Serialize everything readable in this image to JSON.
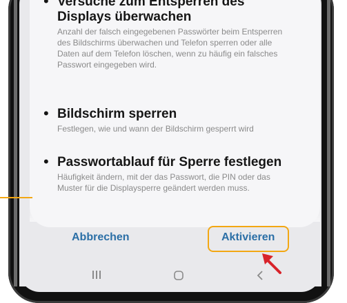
{
  "items": [
    {
      "title": "Versuche zum Entsperren des Displays überwachen",
      "desc": "Anzahl der falsch eingegebenen Passwörter beim Entsperren des Bildschirms überwachen und Telefon sperren oder alle Daten auf dem Telefon löschen, wenn zu häufig ein falsches Passwort eingegeben wird."
    },
    {
      "title": "Bildschirm sperren",
      "desc": "Festlegen, wie und wann der Bildschirm gesperrt wird"
    },
    {
      "title": "Passwortablauf für Sperre festlegen",
      "desc": "Häufigkeit ändern, mit der das Passwort, die PIN oder das Muster für die Displaysperre geändert werden muss."
    }
  ],
  "buttons": {
    "cancel": "Abbrechen",
    "activate": "Aktivieren"
  },
  "colors": {
    "accent": "#2b6fa6",
    "highlight": "#f3a712",
    "arrow": "#d8232a"
  },
  "nav": {
    "recent_icon": "recent-apps-icon",
    "home_icon": "home-icon",
    "back_icon": "back-icon"
  }
}
